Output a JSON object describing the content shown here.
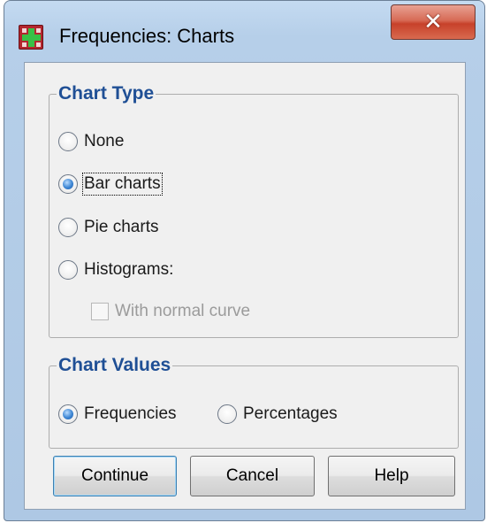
{
  "window": {
    "title": "Frequencies: Charts"
  },
  "chart_type": {
    "legend": "Chart Type",
    "options": [
      {
        "label": "None",
        "selected": false
      },
      {
        "label": "Bar charts",
        "selected": true
      },
      {
        "label": "Pie charts",
        "selected": false
      },
      {
        "label": "Histograms:",
        "selected": false
      }
    ],
    "normal_curve": {
      "label": "With normal curve",
      "checked": false,
      "enabled": false
    }
  },
  "chart_values": {
    "legend": "Chart Values",
    "options": [
      {
        "label": "Frequencies",
        "selected": true
      },
      {
        "label": "Percentages",
        "selected": false
      }
    ]
  },
  "buttons": {
    "continue": "Continue",
    "cancel": "Cancel",
    "help": "Help"
  },
  "icons": {
    "app": "spss-frequencies-icon",
    "close": "close-icon"
  },
  "colors": {
    "legend_text": "#1f4f95",
    "close_button": "#c7412a",
    "window_frame": "#b6cfe9"
  }
}
